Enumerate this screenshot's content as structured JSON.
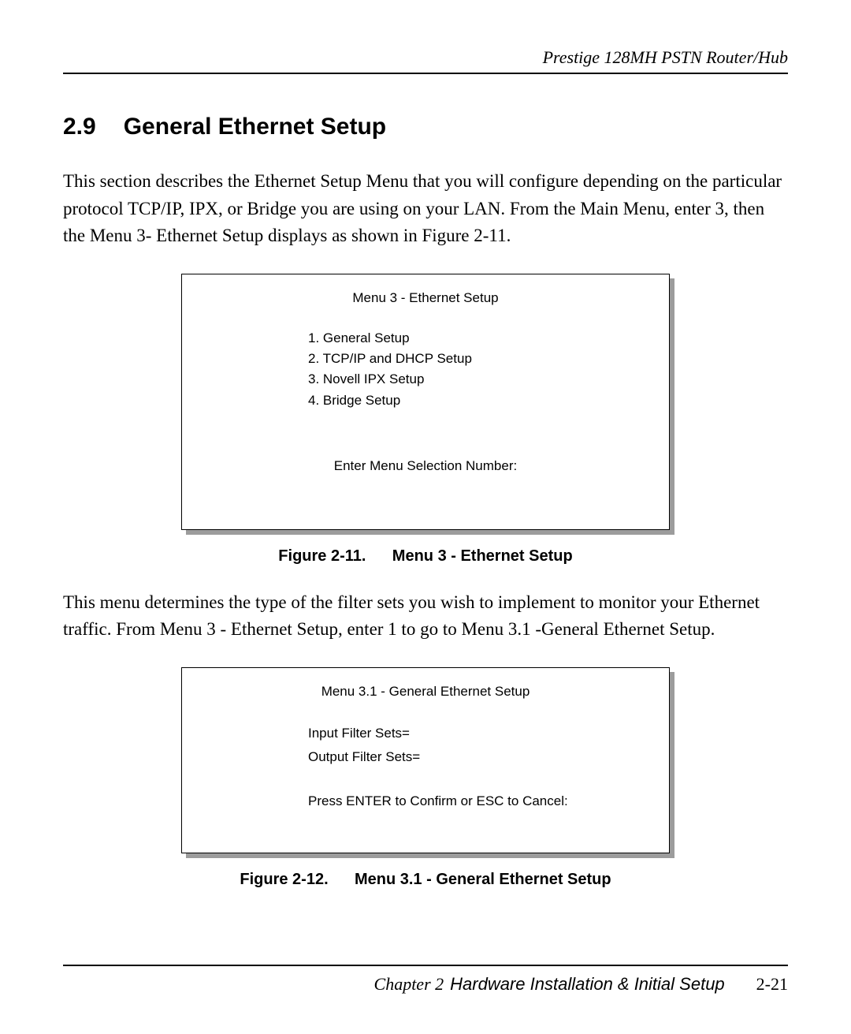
{
  "header": {
    "product": "Prestige 128MH    PSTN Router/Hub"
  },
  "section": {
    "number": "2.9",
    "title": "General Ethernet Setup"
  },
  "paragraph1": "This section describes the Ethernet Setup Menu that you will configure depending on the particular protocol TCP/IP, IPX, or Bridge you are using on your LAN. From the Main Menu, enter 3, then the Menu 3- Ethernet Setup displays as shown in Figure 2-11.",
  "figure1": {
    "menu_title": "Menu 3 - Ethernet Setup",
    "items": {
      "i1": "1. General Setup",
      "i2": "2. TCP/IP and DHCP Setup",
      "i3": "3. Novell IPX Setup",
      "i4": "4. Bridge Setup"
    },
    "prompt": "Enter Menu Selection Number:",
    "caption": "Figure 2-11.      Menu 3 - Ethernet Setup"
  },
  "paragraph2": "This menu determines the type of the filter sets you wish to implement to monitor your Ethernet traffic. From Menu 3 - Ethernet Setup, enter 1 to go to Menu 3.1 -General Ethernet Setup.",
  "figure2": {
    "menu_title": "Menu 3.1 - General Ethernet Setup",
    "fields": {
      "f1": "Input Filter Sets=",
      "f2": "Output Filter Sets="
    },
    "prompt": "Press ENTER to Confirm or ESC to Cancel:",
    "caption": "Figure 2-12.      Menu 3.1 - General Ethernet Setup"
  },
  "footer": {
    "chapter_label": "Chapter 2",
    "chapter_title": "Hardware Installation & Initial Setup",
    "page": "2-21"
  }
}
